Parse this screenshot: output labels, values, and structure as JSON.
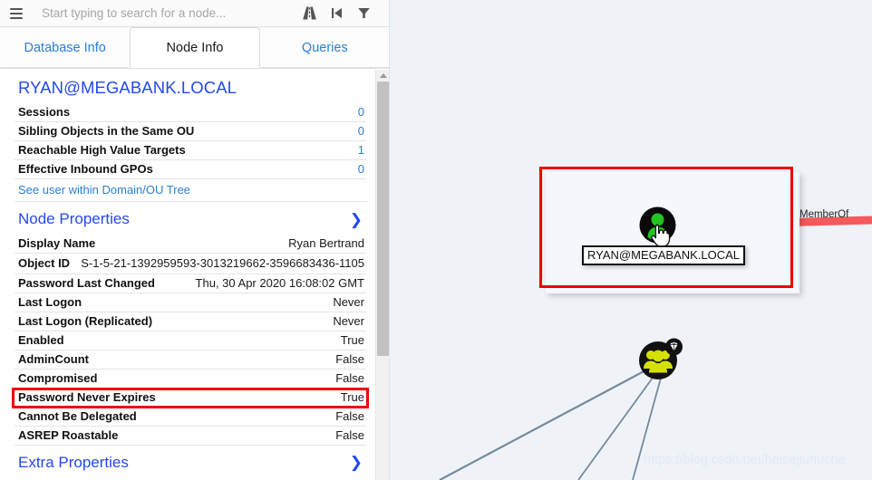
{
  "search": {
    "placeholder": "Start typing to search for a node...",
    "value": "",
    "menu_icon": "hamburger-icon",
    "icons": [
      {
        "name": "pathfinding-road-icon",
        "label": "Pathfinding"
      },
      {
        "name": "skip-to-start-icon",
        "label": "Skip to start"
      },
      {
        "name": "filter-icon",
        "label": "Filter"
      }
    ]
  },
  "tabs": [
    {
      "label": "Database Info",
      "active": false
    },
    {
      "label": "Node Info",
      "active": true
    },
    {
      "label": "Queries",
      "active": false
    }
  ],
  "node_info": {
    "title": "RYAN@MEGABANK.LOCAL",
    "counts": [
      {
        "label": "Sessions",
        "value": "0"
      },
      {
        "label": "Sibling Objects in the Same OU",
        "value": "0"
      },
      {
        "label": "Reachable High Value Targets",
        "value": "1"
      },
      {
        "label": "Effective Inbound GPOs",
        "value": "0"
      }
    ],
    "tree_link": "See user within Domain/OU Tree",
    "sections": [
      {
        "title": "Node Properties",
        "chevron": "chevron-down-icon",
        "expanded": true,
        "properties": [
          {
            "label": "Display Name",
            "value": "Ryan Bertrand",
            "highlighted": false
          },
          {
            "label": "Object ID",
            "value": "S-1-5-21-1392959593-3013219662-3596683436-1105",
            "highlighted": false
          },
          {
            "label": "Password Last Changed",
            "value": "Thu, 30 Apr 2020 16:08:02 GMT",
            "highlighted": false
          },
          {
            "label": "Last Logon",
            "value": "Never",
            "highlighted": false
          },
          {
            "label": "Last Logon (Replicated)",
            "value": "Never",
            "highlighted": false
          },
          {
            "label": "Enabled",
            "value": "True",
            "highlighted": false
          },
          {
            "label": "AdminCount",
            "value": "False",
            "highlighted": false
          },
          {
            "label": "Compromised",
            "value": "False",
            "highlighted": false
          },
          {
            "label": "Password Never Expires",
            "value": "True",
            "highlighted": true
          },
          {
            "label": "Cannot Be Delegated",
            "value": "False",
            "highlighted": false
          },
          {
            "label": "ASREP Roastable",
            "value": "False",
            "highlighted": false
          }
        ]
      },
      {
        "title": "Extra Properties",
        "chevron": "chevron-down-icon",
        "expanded": false,
        "properties": []
      }
    ]
  },
  "graph": {
    "selected_node_label": "RYAN@MEGABANK.LOCAL",
    "edge_label": "MemberOf",
    "nodes": [
      {
        "id": "user",
        "type": "user",
        "label": "RYAN@MEGABANK.LOCAL",
        "color": "#22c522",
        "selected": true,
        "high_value": false
      },
      {
        "id": "group",
        "type": "group",
        "label": "",
        "color": "#d6e000",
        "selected": false,
        "high_value": true
      }
    ],
    "edge_color": "#f4595b",
    "line_color": "#748a9d",
    "watermark": "https://blog.csdn.net/heisejiuhuche"
  },
  "colors": {
    "accent_blue": "#2a7fd4",
    "title_blue": "#2449f0",
    "highlight_red": "#ee0000",
    "canvas_bg": "#eff3f8",
    "user_node_green": "#22c522",
    "group_node_yellow": "#d6e000"
  }
}
